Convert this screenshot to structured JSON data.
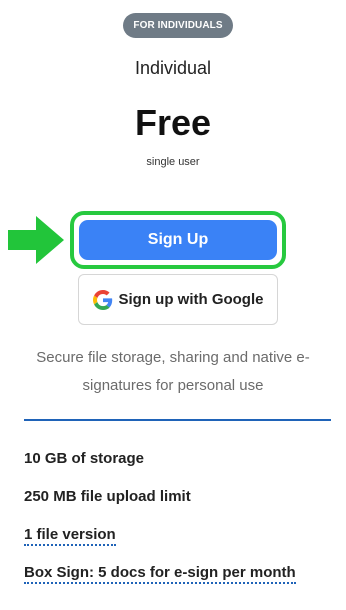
{
  "plan": {
    "badge": "FOR INDIVIDUALS",
    "name": "Individual",
    "price": "Free",
    "users": "single user"
  },
  "actions": {
    "signup_label": "Sign Up",
    "google_label": "Sign up with Google",
    "highlight_color": "#27c93f",
    "primary_color": "#3a82f6"
  },
  "description": "Secure file storage, sharing and native e-signatures for personal use",
  "features": [
    {
      "label": "10 GB of storage"
    },
    {
      "label": "250 MB file upload limit"
    },
    {
      "label": "1 file version"
    },
    {
      "label": "Box Sign: 5 docs for e-sign per month"
    }
  ],
  "icons": {
    "arrow": "arrow-right-icon",
    "google": "google-logo-icon"
  }
}
